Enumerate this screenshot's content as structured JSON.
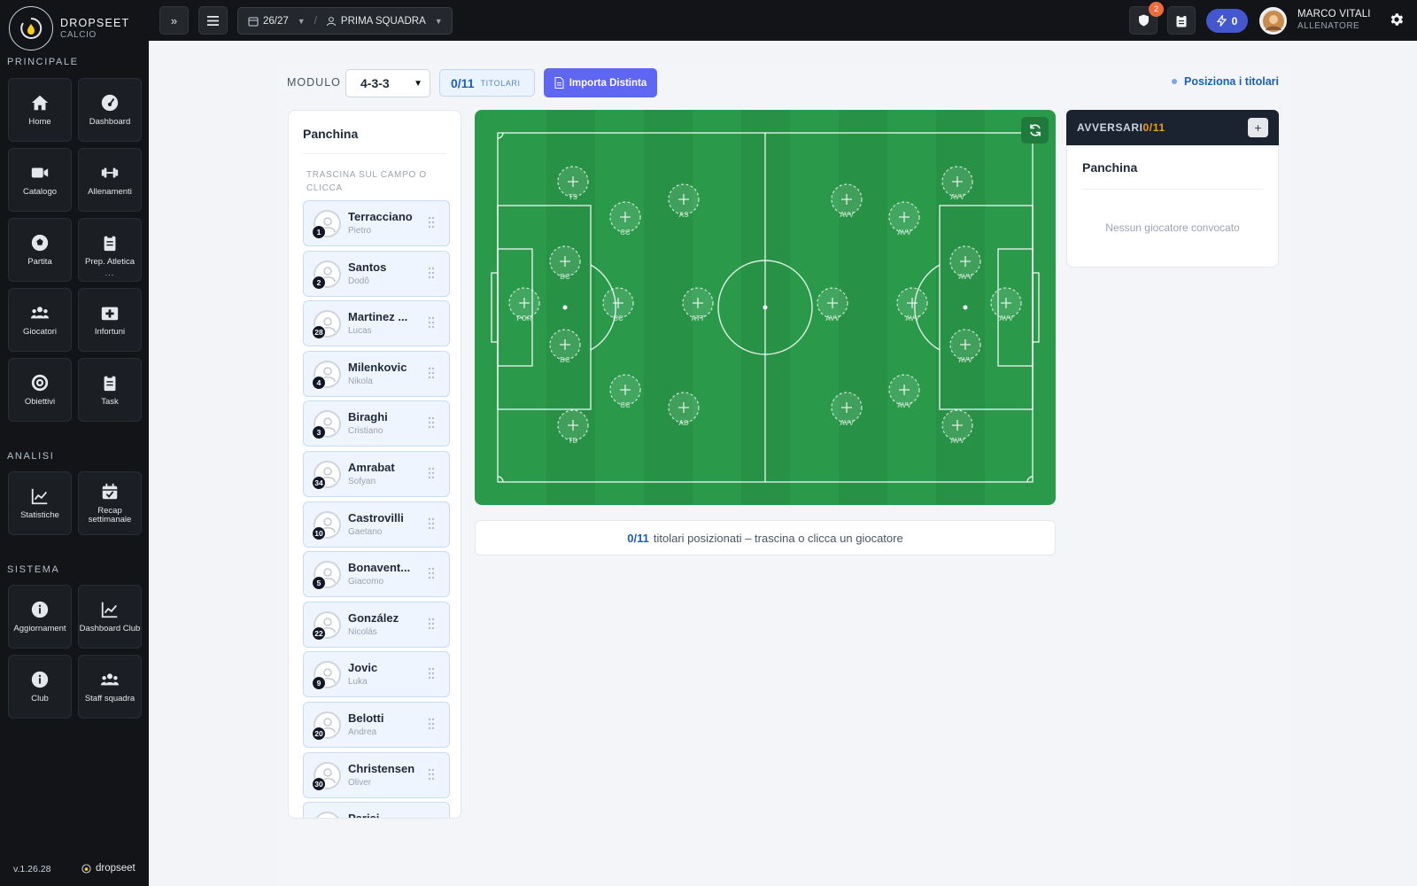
{
  "brand": {
    "name": "DROPSEET",
    "sub": "CALCIO"
  },
  "sidebar": {
    "sections": [
      {
        "title": "PRINCIPALE",
        "items": [
          {
            "label": "Home",
            "icon": "home-icon"
          },
          {
            "label": "Dashboard",
            "icon": "dashboard-gauge-icon"
          },
          {
            "label": "Catalogo",
            "icon": "video-camera-icon"
          },
          {
            "label": "Allenamenti",
            "icon": "dumbbell-icon"
          },
          {
            "label": "Partita",
            "icon": "soccer-ball-icon"
          },
          {
            "label": "Prep. Atletica",
            "icon": "clipboard-icon",
            "more": "..."
          },
          {
            "label": "Giocatori",
            "icon": "users-icon"
          },
          {
            "label": "Infortuni",
            "icon": "medkit-icon"
          },
          {
            "label": "Obiettivi",
            "icon": "target-icon"
          },
          {
            "label": "Task",
            "icon": "clipboard-icon"
          }
        ]
      },
      {
        "title": "ANALISI",
        "items": [
          {
            "label": "Statistiche",
            "icon": "line-chart-icon"
          },
          {
            "label": "Recap settimanale",
            "icon": "calendar-check-icon"
          }
        ]
      },
      {
        "title": "SISTEMA",
        "items": [
          {
            "label": "Aggiornament",
            "icon": "info-icon"
          },
          {
            "label": "Dashboard Club",
            "icon": "line-chart-icon"
          },
          {
            "label": "Club",
            "icon": "info-icon"
          },
          {
            "label": "Staff squadra",
            "icon": "users-icon"
          }
        ]
      }
    ],
    "version": "v.1.26.28",
    "footer_brand": "dropseet"
  },
  "topbar": {
    "expand_label": "»",
    "season": "26/27",
    "team": "PRIMA SQUADRA",
    "notifications_count": "2",
    "bolt_count": "0",
    "user": {
      "name": "MARCO VITALI",
      "role": "ALLENATORE"
    }
  },
  "toolbar": {
    "modulo_label": "MODULO",
    "modulo_value": "4-3-3",
    "titolari_count": "0/11",
    "titolari_label": "TITOLARI",
    "import_label": "Importa Distinta",
    "posiziona_label": "Posiziona i titolari"
  },
  "bench": {
    "title": "Panchina",
    "hint": "TRASCINA SUL CAMPO O CLICCA",
    "players": [
      {
        "surname": "Terracciano",
        "first": "Pietro",
        "number": "1"
      },
      {
        "surname": "Santos",
        "first": "Dodô",
        "number": "2"
      },
      {
        "surname": "Martinez ...",
        "first": "Lucas",
        "number": "28"
      },
      {
        "surname": "Milenkovic",
        "first": "Nikola",
        "number": "4"
      },
      {
        "surname": "Biraghi",
        "first": "Cristiano",
        "number": "3"
      },
      {
        "surname": "Amrabat",
        "first": "Sofyan",
        "number": "34"
      },
      {
        "surname": "Castrovilli",
        "first": "Gaetano",
        "number": "10"
      },
      {
        "surname": "Bonavent...",
        "first": "Giacomo",
        "number": "5"
      },
      {
        "surname": "González",
        "first": "Nicolás",
        "number": "22"
      },
      {
        "surname": "Jovic",
        "first": "Luka",
        "number": "9"
      },
      {
        "surname": "Belotti",
        "first": "Andrea",
        "number": "20"
      },
      {
        "surname": "Christensen",
        "first": "Oliver",
        "number": "30"
      },
      {
        "surname": "Parisi",
        "first": "",
        "number": ""
      }
    ]
  },
  "pitch": {
    "home_roles": [
      "POR",
      "DC",
      "DC",
      "TS",
      "TD",
      "CC",
      "CC",
      "CC",
      "AS",
      "AD",
      "ATT"
    ],
    "away_roles": [
      "AVV",
      "AVV",
      "AVV",
      "AVV",
      "AVV",
      "AVV",
      "AVV",
      "AVV",
      "AVV",
      "AVV",
      "AVV"
    ],
    "pitch_color": "#2a9a4a"
  },
  "status": {
    "count": "0/11",
    "text": "titolari posizionati – trascina o clicca un giocatore"
  },
  "opponents": {
    "title": "AVVERSARI",
    "count": "0/11",
    "add_label": "+",
    "bench_title": "Panchina",
    "empty_text": "Nessun giocatore convocato"
  }
}
